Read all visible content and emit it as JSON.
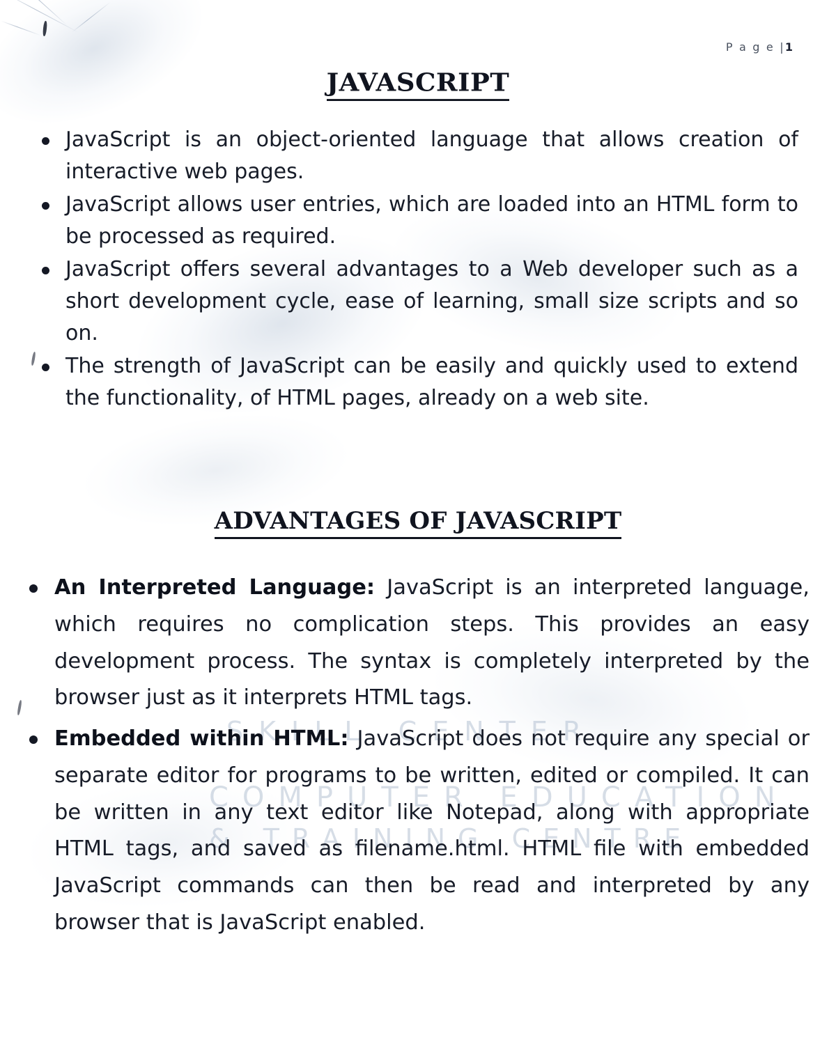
{
  "document": {
    "page_label_prefix": "P a g e |",
    "page_number": "1",
    "title": "JAVASCRIPT",
    "section_title": "ADVANTAGES OF JAVASCRIPT"
  },
  "intro_bullets": [
    "JavaScript is an object-oriented language that allows creation of interactive web pages.",
    "JavaScript allows user entries, which are loaded into an HTML form to be processed as required.",
    "JavaScript offers several advantages to a Web developer such as a short development cycle, ease of learning, small size scripts and so on.",
    "The strength of JavaScript can be easily and quickly used to extend the functionality, of HTML pages, already on a web site."
  ],
  "advantages": [
    {
      "lead": "An Interpreted Language:",
      "text": " JavaScript is an interpreted language, which requires no complication steps. This provides an easy development process. The syntax is completely interpreted by the browser just as it interprets HTML tags."
    },
    {
      "lead": "Embedded within HTML:",
      "text": " JavaScript does not require any special or separate editor for programs to be written, edited or compiled. It can be written in any text editor like Notepad, along with appropriate HTML tags, and saved as filename.html. HTML file with embedded JavaScript commands can then be read and interpreted by any browser that is JavaScript enabled."
    }
  ],
  "watermark": {
    "line1": "SKILL CENTER",
    "line2": "COMPUTER EDUCATION",
    "line3": "& TRAINING CENTRE",
    "color": "#9fb0c6"
  },
  "colors": {
    "page_background": "#ffffff",
    "text": "#171c28",
    "heading": "#10141f",
    "page_number": "#4a5260"
  }
}
